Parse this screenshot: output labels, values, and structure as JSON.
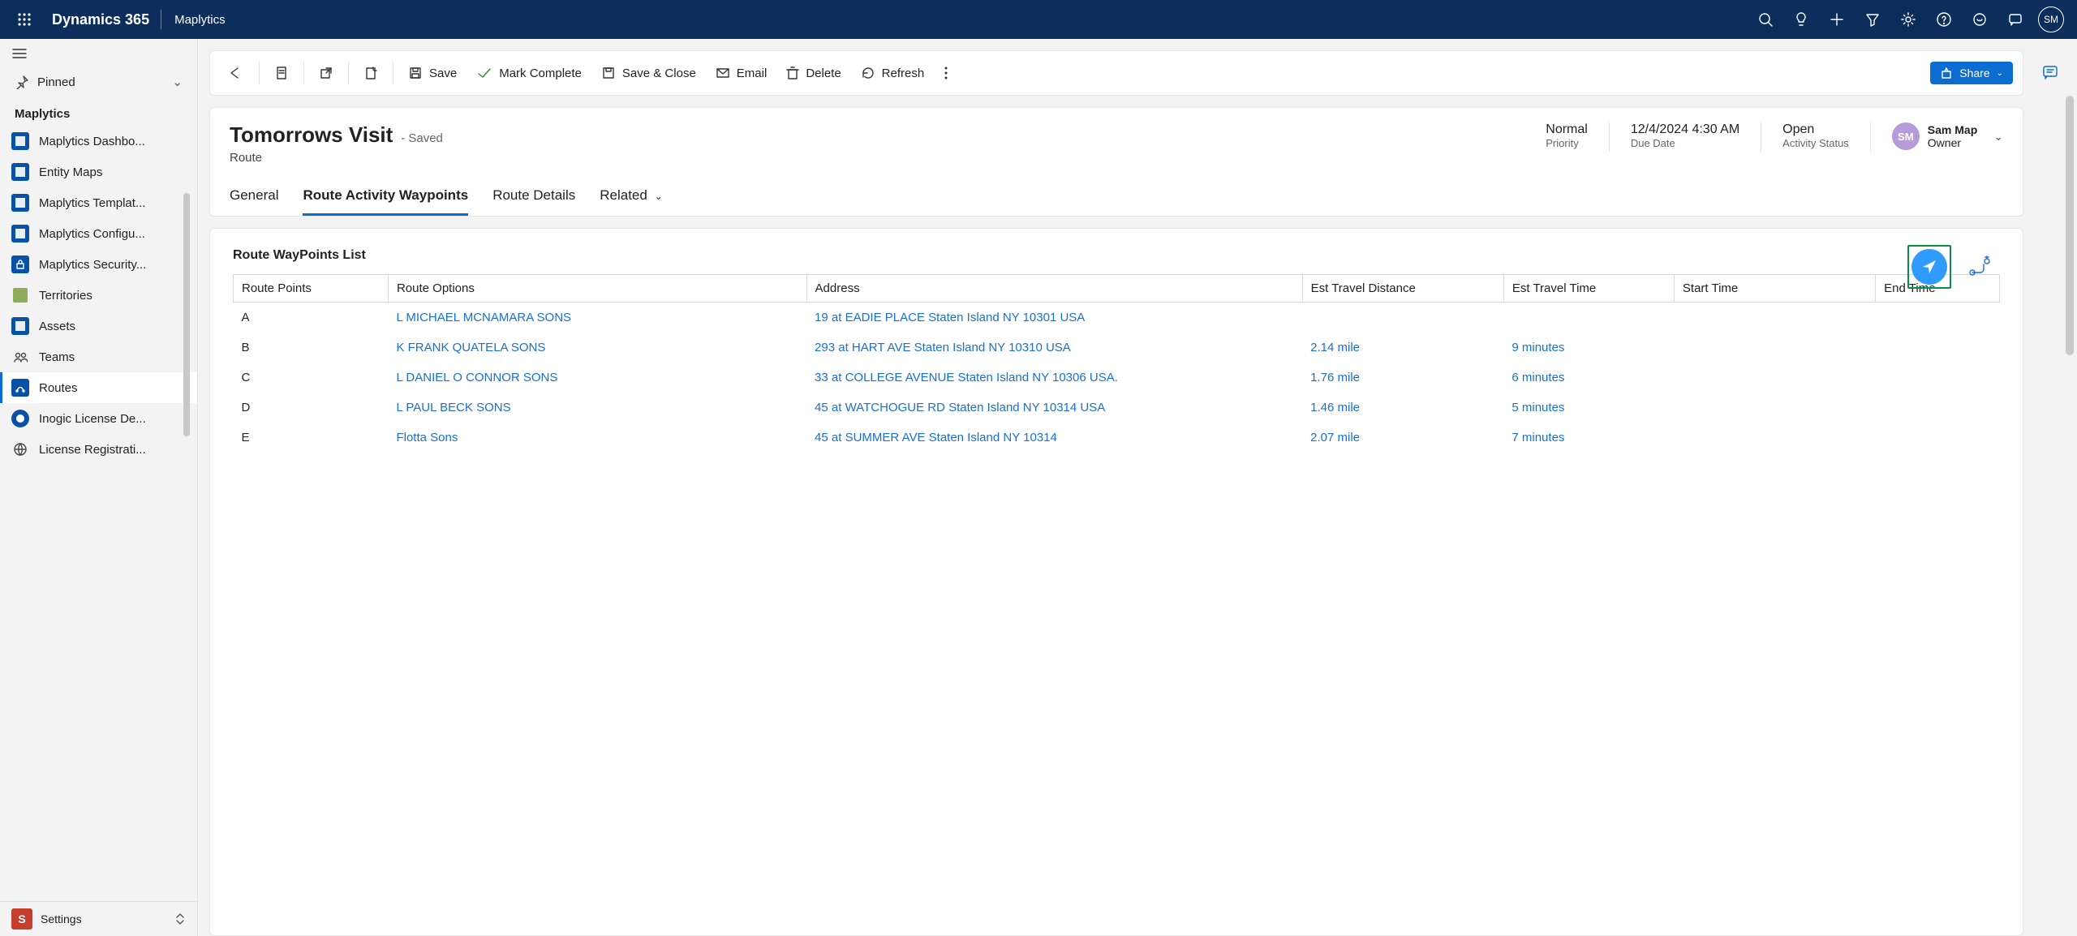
{
  "topbar": {
    "brand": "Dynamics 365",
    "app": "Maplytics",
    "avatar": "SM"
  },
  "sidebar": {
    "pinned": "Pinned",
    "group": "Maplytics",
    "items": [
      {
        "label": "Maplytics Dashbo...",
        "bg": "#0851a6"
      },
      {
        "label": "Entity Maps",
        "bg": "#0851a6"
      },
      {
        "label": "Maplytics Templat...",
        "bg": "#0851a6"
      },
      {
        "label": "Maplytics Configu...",
        "bg": "#0851a6"
      },
      {
        "label": "Maplytics Security...",
        "bg": "#0851a6"
      },
      {
        "label": "Territories",
        "bg": "#8eac5b"
      },
      {
        "label": "Assets",
        "bg": "#0851a6"
      },
      {
        "label": "Teams",
        "bg": "transparent"
      },
      {
        "label": "Routes",
        "bg": "#0851a6",
        "selected": true
      },
      {
        "label": "Inogic License De...",
        "bg": "#0851a6"
      },
      {
        "label": "License Registrati...",
        "bg": "transparent"
      }
    ],
    "settings_initial": "S",
    "settings": "Settings"
  },
  "cmd": {
    "save": "Save",
    "complete": "Mark Complete",
    "saveclose": "Save & Close",
    "email": "Email",
    "delete": "Delete",
    "refresh": "Refresh",
    "share": "Share"
  },
  "record": {
    "title": "Tomorrows Visit",
    "status": "- Saved",
    "entity": "Route",
    "priority": {
      "v": "Normal",
      "l": "Priority"
    },
    "due": {
      "v": "12/4/2024 4:30 AM",
      "l": "Due Date"
    },
    "activity": {
      "v": "Open",
      "l": "Activity Status"
    },
    "owner": {
      "initials": "SM",
      "name": "Sam Map",
      "l": "Owner"
    }
  },
  "tabs": {
    "general": "General",
    "waypoints": "Route Activity Waypoints",
    "details": "Route Details",
    "related": "Related"
  },
  "section": {
    "title": "Route WayPoints List",
    "cols": {
      "p": "Route Points",
      "o": "Route Options",
      "a": "Address",
      "d": "Est Travel Distance",
      "t": "Est Travel Time",
      "s": "Start Time",
      "e": "End Time"
    },
    "rows": [
      {
        "p": "A",
        "o": "L MICHAEL MCNAMARA SONS",
        "a": "19 at EADIE PLACE Staten Island NY 10301 USA",
        "d": "",
        "t": ""
      },
      {
        "p": "B",
        "o": "K FRANK QUATELA SONS",
        "a": "293 at HART AVE Staten Island NY 10310 USA",
        "d": "2.14 mile",
        "t": "9 minutes"
      },
      {
        "p": "C",
        "o": "L DANIEL O CONNOR SONS",
        "a": "33 at COLLEGE AVENUE Staten Island NY 10306 USA.",
        "d": "1.76 mile",
        "t": "6 minutes"
      },
      {
        "p": "D",
        "o": "L PAUL BECK SONS",
        "a": "45 at WATCHOGUE RD Staten Island NY 10314 USA",
        "d": "1.46 mile",
        "t": "5 minutes"
      },
      {
        "p": "E",
        "o": "Flotta Sons",
        "a": "45 at SUMMER AVE Staten Island NY 10314",
        "d": "2.07 mile",
        "t": "7 minutes"
      }
    ]
  }
}
